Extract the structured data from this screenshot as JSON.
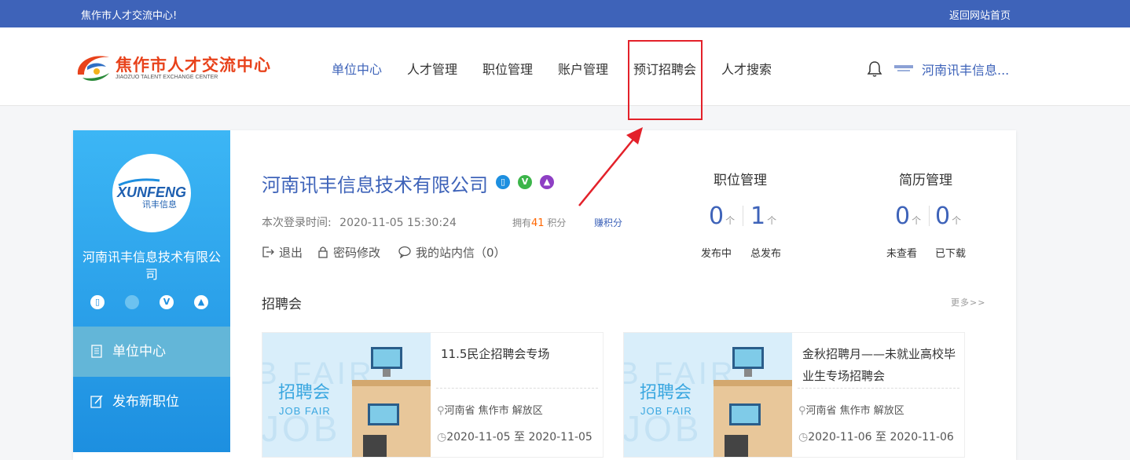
{
  "topbar": {
    "welcome": "焦作市人才交流中心!",
    "home_link": "返回网站首页"
  },
  "logo": {
    "title": "焦作市人才交流中心",
    "subtitle": "JIAOZUO TALENT EXCHANGE CENTER"
  },
  "nav": [
    "单位中心",
    "人才管理",
    "职位管理",
    "账户管理",
    "预订招聘会",
    "人才搜索"
  ],
  "header_user": {
    "name": "河南讯丰信息...",
    "bell_icon": "bell-icon"
  },
  "sidebar": {
    "company_name": "河南讯丰信息技术有限公司",
    "logo_text": "XUNFENG",
    "logo_sub": "讯丰信息",
    "menu": [
      "单位中心",
      "发布新职位"
    ]
  },
  "company": {
    "name": "河南讯丰信息技术有限公司",
    "login_label": "本次登录时间:",
    "login_time": "2020-11-05 15:30:24",
    "points_prefix": "拥有",
    "points": "41",
    "points_suffix": "积分",
    "earn_points": "赚积分",
    "logout": "退出",
    "change_password": "密码修改",
    "messages": "我的站内信（0）"
  },
  "stats": {
    "jobs_title": "职位管理",
    "resumes_title": "简历管理",
    "unit": "个",
    "jobs_active": "0",
    "jobs_active_label": "发布中",
    "jobs_total": "1",
    "jobs_total_label": "总发布",
    "resumes_unviewed": "0",
    "resumes_unviewed_label": "未查看",
    "resumes_downloaded": "0",
    "resumes_downloaded_label": "已下载"
  },
  "fairs_section": {
    "title": "招聘会",
    "more": "更多>>",
    "img_title": "招聘会",
    "img_sub": "JOB FAIR",
    "items": [
      {
        "name": "11.5民企招聘会专场",
        "location": "河南省 焦作市 解放区",
        "date": "2020-11-05 至 2020-11-05"
      },
      {
        "name": "金秋招聘月——未就业高校毕业生专场招聘会",
        "location": "河南省 焦作市 解放区",
        "date": "2020-11-06 至 2020-11-06"
      }
    ]
  },
  "colors": {
    "brand": "#3e63b9",
    "highlight": "#e3212a",
    "sidebar": "#1d8fe0",
    "points": "#ff6600"
  }
}
